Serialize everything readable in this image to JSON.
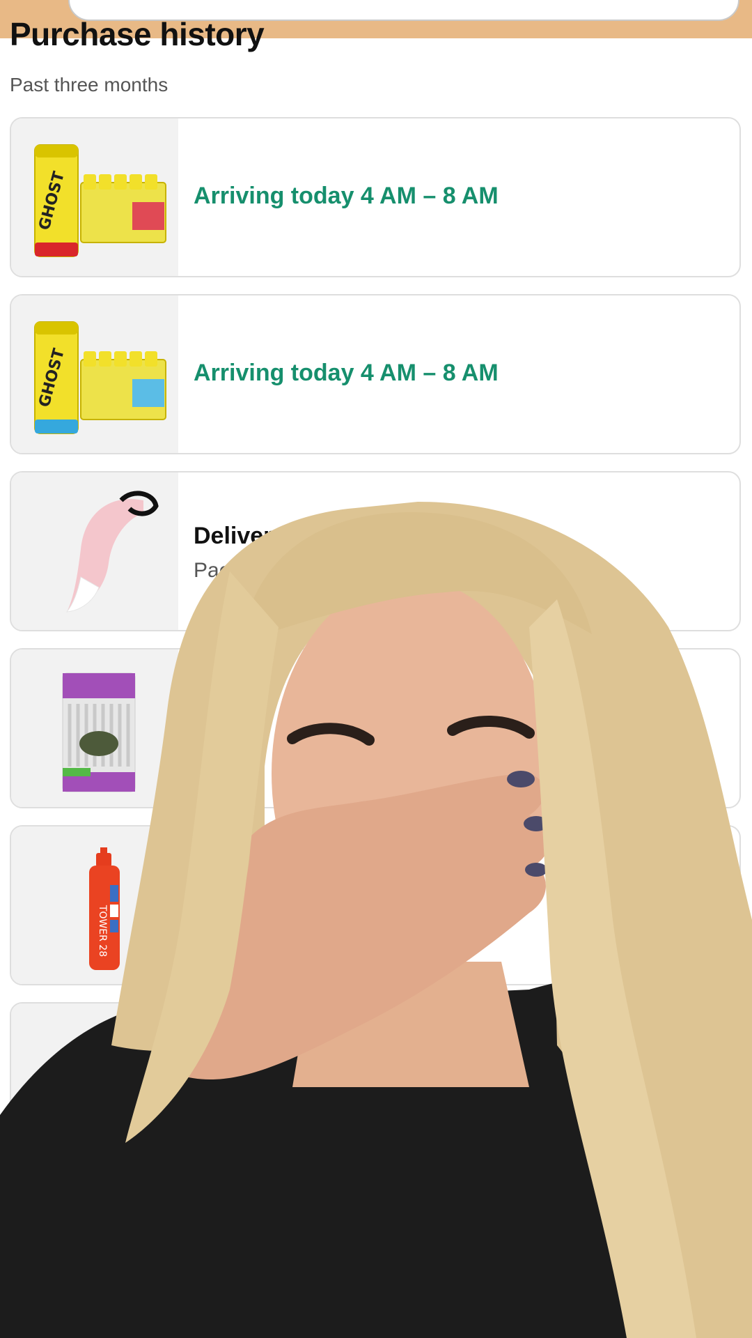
{
  "header": {
    "title": "Purchase history",
    "subtitle": "Past three months"
  },
  "orders": [
    {
      "status": "Arriving today 4 AM – 8 AM",
      "detail": "",
      "product_icon": "energy-drink-pack-red-icon"
    },
    {
      "status": "Arriving today 4 AM – 8 AM",
      "detail": "",
      "product_icon": "energy-drink-pack-blue-icon"
    },
    {
      "status": "Delivered May 5",
      "detail": "Package was",
      "product_icon": "costume-tail-icon"
    },
    {
      "status": "",
      "detail": "",
      "product_icon": "bamboo-straws-pack-icon"
    },
    {
      "status": "",
      "detail": "",
      "product_icon": "hair-spray-bottle-icon"
    },
    {
      "status": "",
      "detail": "",
      "product_icon": "paw-item-icon"
    }
  ],
  "colors": {
    "top_bar": "#e8b986",
    "arriving_green": "#168f6d",
    "card_border": "#dedede"
  }
}
